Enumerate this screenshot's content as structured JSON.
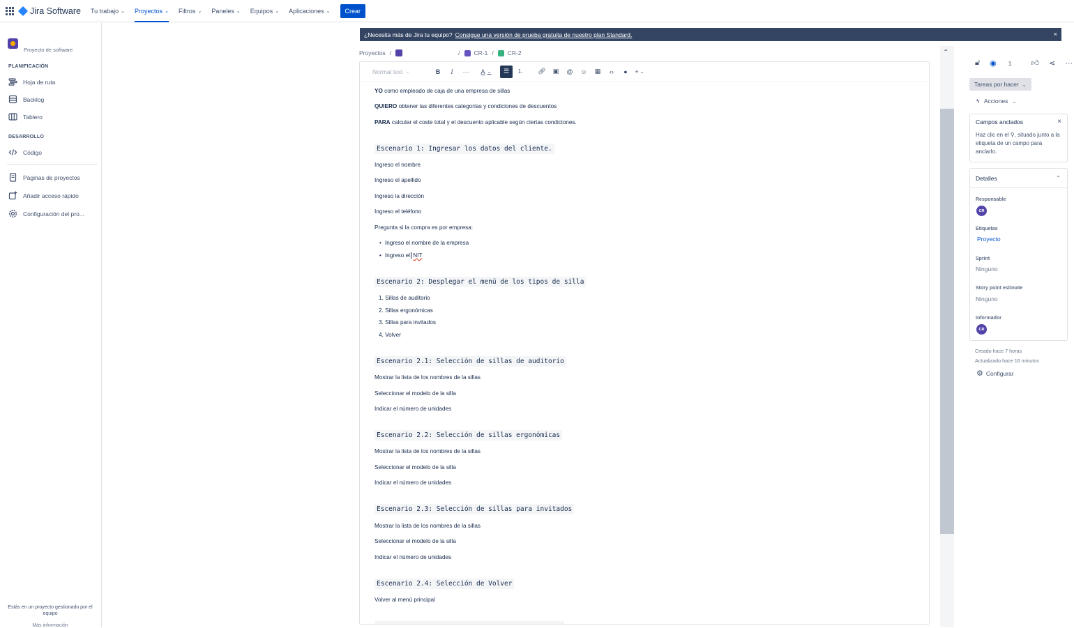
{
  "topnav": {
    "product": "Jira Software",
    "items": [
      {
        "label": "Tu trabajo"
      },
      {
        "label": "Proyectos"
      },
      {
        "label": "Filtros"
      },
      {
        "label": "Paneles"
      },
      {
        "label": "Equipos"
      },
      {
        "label": "Aplicaciones"
      }
    ],
    "create_label": "Crear"
  },
  "sidebar": {
    "project_type": "Proyecto de software",
    "planning_section": "PLANIFICACIÓN",
    "dev_section": "DESARROLLO",
    "items": {
      "roadmap": "Hoja de ruta",
      "backlog": "Backlog",
      "board": "Tablero",
      "code": "Código",
      "pages": "Páginas de proyectos",
      "shortcut": "Añadir acceso rápido",
      "settings": "Configuración del pro..."
    },
    "footer": "Estás en un proyecto gestionado por el equipo",
    "footer_link": "Más información"
  },
  "banner": {
    "text": "¿Necesita más de Jira tu equipo?",
    "link": "Consigue una versión de prueba gratuita de nuestro plan Standard.",
    "close": "×"
  },
  "breadcrumb": {
    "projects": "Proyectos",
    "epic": "CR-1",
    "issue": "CR-2"
  },
  "toolbar": {
    "text_style": "Normal text",
    "bold": "B",
    "italic": "I",
    "more": "···",
    "color": "A"
  },
  "doc": {
    "yo_kw": "YO",
    "yo_text": "como empleado de caja de una empresa de sillas",
    "quiero_kw": "QUIERO",
    "quiero_text": "obtener las diferentes categorías y condiciones de descuentos",
    "para_kw": "PARA",
    "para_text": "calcular el coste total y el descuento aplicable según ciertas condiciones.",
    "esc1": "Escenario 1: Ingresar los datos del cliente.",
    "e1_l1": "Ingreso el nombre",
    "e1_l2": "Ingreso el apellido",
    "e1_l3": "Ingreso la dirección",
    "e1_l4": "Ingreso el teléfono",
    "e1_l5": "Pregunta si la compra es por empresa:",
    "e1_b1": "Ingreso el nombre de la empresa",
    "e1_b2_pre": "Ingreso el",
    "e1_b2_word": "NIT",
    "esc2": "Escenario 2: Desplegar el menú de los tipos de silla",
    "e2_o1": "1. Sillas de auditorio",
    "e2_o2": "2. Sillas ergonómicas",
    "e2_o3": "3. Sillas para invitados",
    "e2_o4": "4. Volver",
    "esc21": "Escenario 2.1: Selección de sillas de auditorio",
    "esc22": "Escenario 2.2: Selección de sillas ergonómicas",
    "esc23": "Escenario 2.3: Selección de sillas para invitados",
    "esc24": "Escenario 2.4: Selección de Volver",
    "show_list": "Mostrar la lista de los nombres de la sillas",
    "select_model": "Seleccionar el modelo de la silla",
    "units": "Indicar el número de unidades",
    "back_menu": "Volver al menú principal"
  },
  "right": {
    "watchers": "1",
    "status": "Tareas por hacer",
    "actions": "Acciones",
    "pinned_title": "Campos anclados",
    "pinned_desc": "Haz clic en el ⚲, situado junto a la etiqueta de un campo para anclarlo.",
    "details_title": "Detalles",
    "assignee_label": "Responsable",
    "assignee_initials": "CR",
    "labels_label": "Etiquetas",
    "labels_value": "Proyecto",
    "sprint_label": "Sprint",
    "sprint_value": "Ninguno",
    "estimate_label": "Story point estimate",
    "estimate_value": "Ninguno",
    "reporter_label": "Informador",
    "reporter_initials": "CR",
    "created": "Creado hace 7 horas",
    "updated": "Actualizado hace 16 minutos",
    "configure": "Configurar"
  },
  "colors": {
    "primary": "#0052cc",
    "banner": "#344563",
    "avatar": "#5243aa",
    "story": "#36b37e"
  }
}
